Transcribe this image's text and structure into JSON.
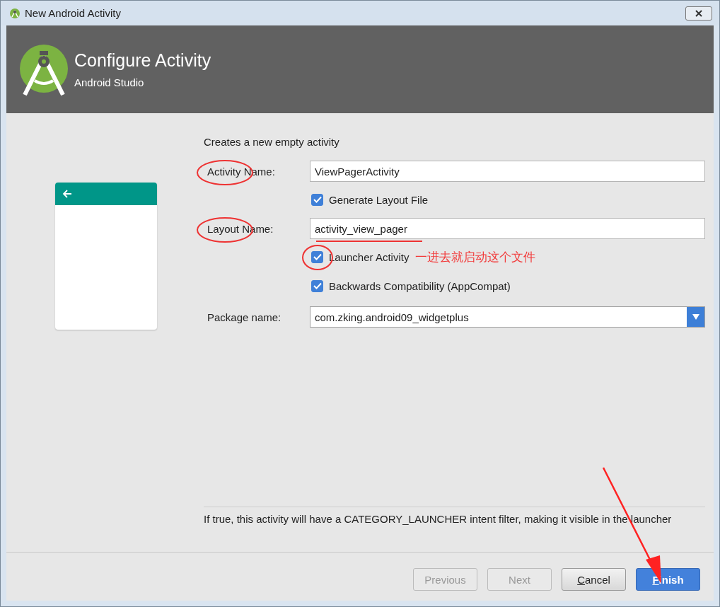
{
  "window": {
    "title": "New Android Activity"
  },
  "header": {
    "title": "Configure Activity",
    "subtitle": "Android Studio"
  },
  "description": "Creates a new empty activity",
  "form": [
    {
      "kind": "field",
      "label": "Activity Name:",
      "value": "ViewPagerActivity",
      "circled": true
    },
    {
      "kind": "checkbox",
      "label": "Generate Layout File",
      "checked": true
    },
    {
      "kind": "field",
      "label": "Layout Name:",
      "value": "activity_view_pager",
      "circled": true,
      "underlined": true
    },
    {
      "kind": "checkbox",
      "label": "Launcher Activity",
      "checked": true,
      "circled": true,
      "note": "一进去就启动这个文件"
    },
    {
      "kind": "checkbox",
      "label": "Backwards Compatibility (AppCompat)",
      "checked": true
    },
    {
      "kind": "dropdown",
      "label": "Package name:",
      "value": "com.zking.android09_widgetplus"
    }
  ],
  "hint": "If true, this activity will have a CATEGORY_LAUNCHER intent filter, making it visible in the launcher",
  "buttons": [
    {
      "label": "Previous",
      "disabled": true,
      "primary": false,
      "mnemonic": false
    },
    {
      "label": "Next",
      "disabled": true,
      "primary": false,
      "mnemonic": false
    },
    {
      "label": "Cancel",
      "disabled": false,
      "primary": false,
      "mnemonic": true
    },
    {
      "label": "Finish",
      "disabled": false,
      "primary": true,
      "mnemonic": true
    }
  ]
}
